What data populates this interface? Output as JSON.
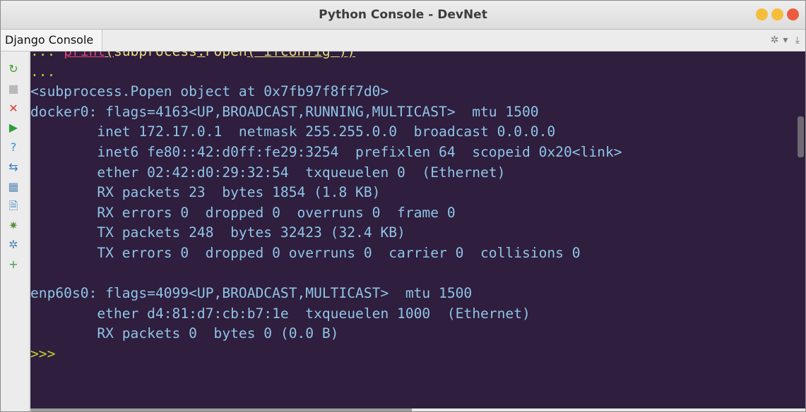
{
  "window": {
    "title": "Python Console - DevNet"
  },
  "tabbar": {
    "active_tab": "Django Console",
    "settings_icon": "gear-icon",
    "settings_icon_glyph": "✲",
    "settings_dropdown_glyph": "▾",
    "hide_icon": "hide-panel-icon",
    "hide_icon_glyph": "⤓"
  },
  "sidebar": {
    "items": [
      {
        "name": "rerun-icon",
        "glyph": "↻",
        "color": "#3f9e2b"
      },
      {
        "name": "stop-icon",
        "glyph": "■",
        "color": "#b9b9b9"
      },
      {
        "name": "close-icon",
        "glyph": "✕",
        "color": "#d9382f"
      },
      {
        "name": "execute-icon",
        "glyph": "▶",
        "color": "#2e9d3f"
      },
      {
        "name": "help-icon",
        "glyph": "?",
        "color": "#2a8fd6"
      },
      {
        "name": "soft-wrap-icon",
        "glyph": "⇆",
        "color": "#3a7abf"
      },
      {
        "name": "variables-icon",
        "glyph": "▦",
        "color": "#5a8bb8"
      },
      {
        "name": "history-icon",
        "glyph": "🗎",
        "color": "#4a86c5"
      },
      {
        "name": "debug-icon",
        "glyph": "✷",
        "color": "#5d8a3a"
      },
      {
        "name": "settings-icon",
        "glyph": "✲",
        "color": "#4f86b9"
      },
      {
        "name": "add-icon",
        "glyph": "+",
        "color": "#3aa14a"
      }
    ]
  },
  "console": {
    "cut_line_prompt": "... ",
    "cut_line_print": "print",
    "cut_line_paren": "(",
    "cut_line_mid": "subprocess",
    "cut_line_dot": ".",
    "cut_line_popen": "Popen",
    "cut_line_arg": "(\"ifconfig\")",
    "cut_line_close": ")",
    "continuation_prompt": "...",
    "output_lines": [
      "<subprocess.Popen object at 0x7fb97f8ff7d0>",
      "docker0: flags=4163<UP,BROADCAST,RUNNING,MULTICAST>  mtu 1500",
      "        inet 172.17.0.1  netmask 255.255.0.0  broadcast 0.0.0.0",
      "        inet6 fe80::42:d0ff:fe29:3254  prefixlen 64  scopeid 0x20<link>",
      "        ether 02:42:d0:29:32:54  txqueuelen 0  (Ethernet)",
      "        RX packets 23  bytes 1854 (1.8 KB)",
      "        RX errors 0  dropped 0  overruns 0  frame 0",
      "        TX packets 248  bytes 32423 (32.4 KB)",
      "        TX errors 0  dropped 0 overruns 0  carrier 0  collisions 0",
      "",
      "enp60s0: flags=4099<UP,BROADCAST,MULTICAST>  mtu 1500",
      "        ether d4:81:d7:cb:b7:1e  txqueuelen 1000  (Ethernet)",
      "        RX packets 0  bytes 0 (0.0 B)"
    ],
    "input_prompt": ">>>"
  },
  "colors": {
    "console_background": "#2f1e3d",
    "output_text": "#8fc4e8",
    "prompt": "#c8cf34",
    "keyword": "#e0457b",
    "string": "#e6dc7a"
  }
}
